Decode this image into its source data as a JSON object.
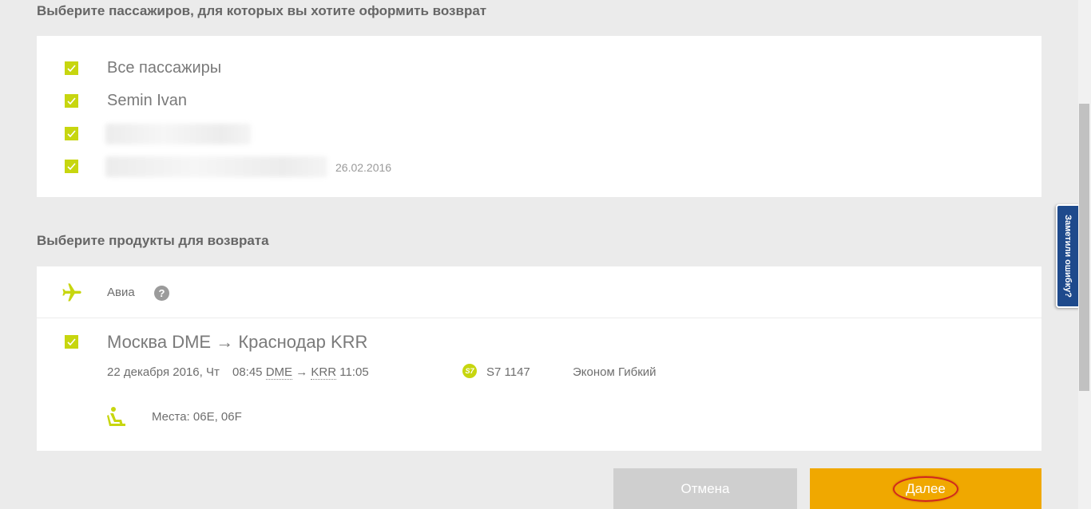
{
  "passengers_section": {
    "title": "Выберите пассажиров, для которых вы хотите оформить возврат",
    "all_label": "Все пассажиры",
    "items": [
      {
        "name": "Semin Ivan",
        "checked": true
      },
      {
        "name": "",
        "checked": true,
        "blurred": true
      },
      {
        "name": "",
        "checked": true,
        "blurred": true,
        "date": "26.02.2016"
      }
    ]
  },
  "products_section": {
    "title": "Выберите продукты для возврата",
    "category_label": "Авиа",
    "help_label": "?",
    "flight": {
      "route": "Москва DME → Краснодар KRR",
      "date": "22 декабря 2016, Чт",
      "departure_time": "08:45",
      "departure_code": "DME",
      "arrow": "→",
      "arrival_code": "KRR",
      "arrival_time": "11:05",
      "airline_logo": "S7",
      "flight_number": "S7 1147",
      "fare": "Эконом Гибкий",
      "seats": "Места: 06E, 06F"
    }
  },
  "buttons": {
    "cancel": "Отмена",
    "next": "Далее"
  },
  "feedback_tab": "Заметили ошибку?",
  "colors": {
    "accent_green": "#c7d60f",
    "next_button": "#f0a800",
    "cancel_button": "#cfcfcf",
    "feedback_tab": "#1e4a8c",
    "highlight_ring": "#d0271f"
  },
  "icons": [
    "check-icon",
    "plane-icon",
    "help-icon",
    "seat-icon",
    "s7-logo"
  ]
}
